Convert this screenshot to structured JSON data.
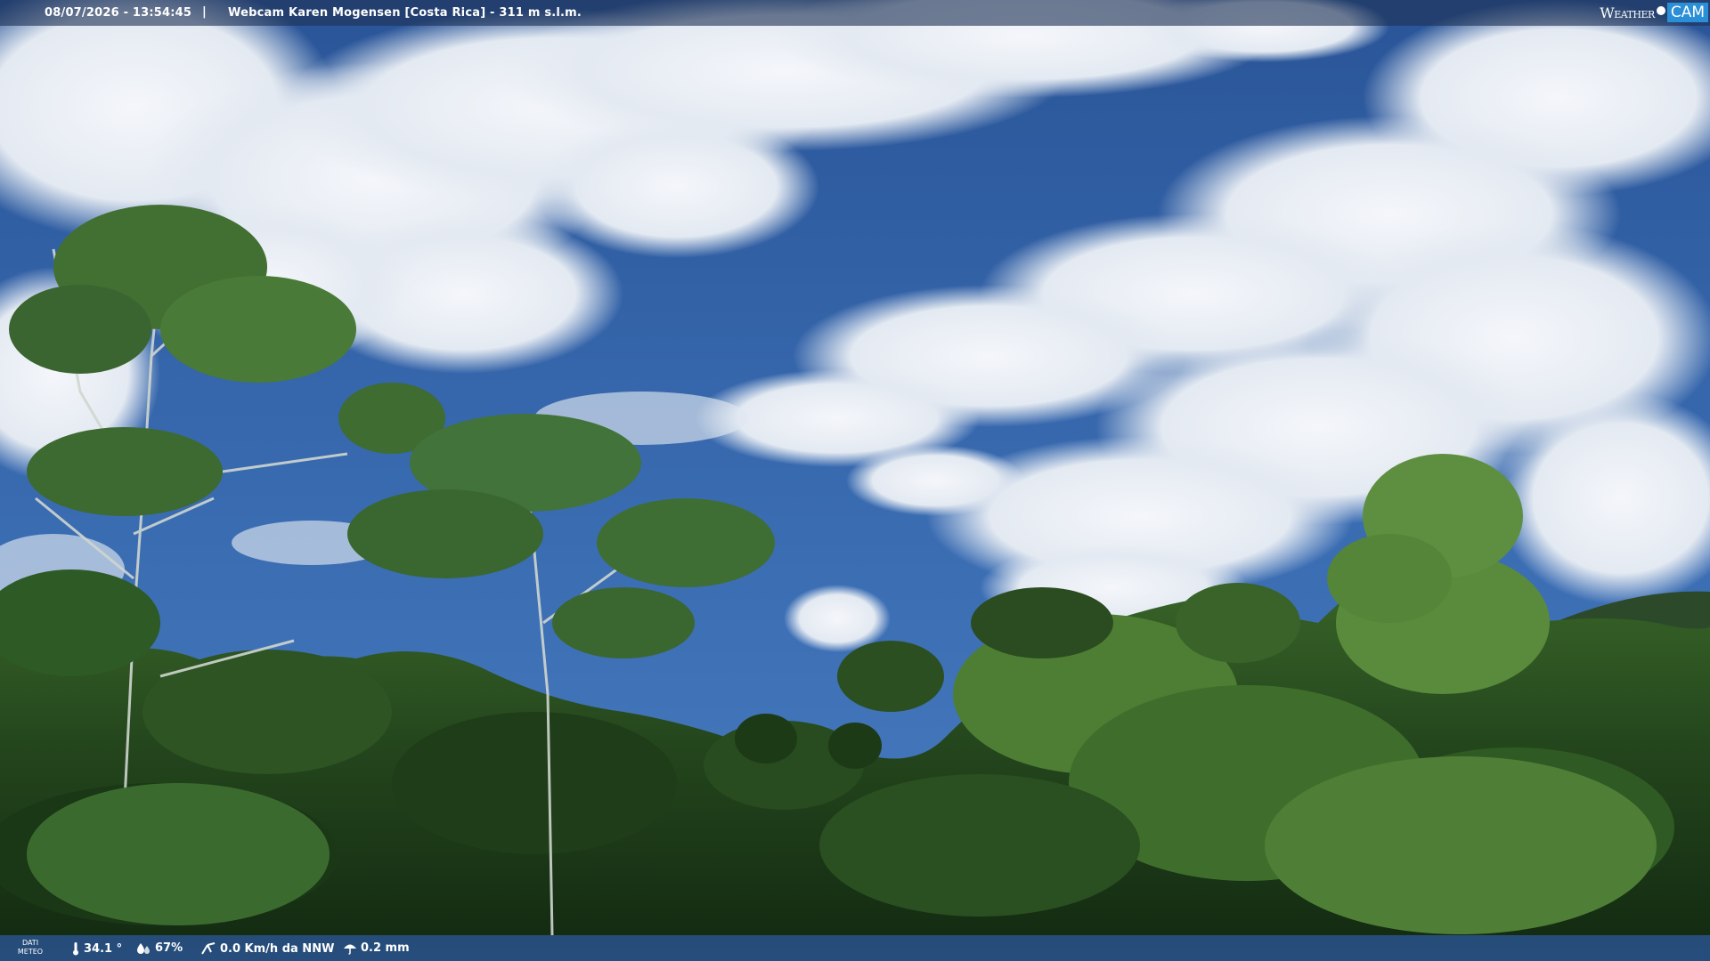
{
  "header": {
    "datetime": "08/07/2026 - 13:54:45",
    "separator": "|",
    "location": "Webcam Karen Mogensen [Costa Rica] - 311 m s.l.m."
  },
  "logo": {
    "weather": "Weather",
    "cam": "CAM"
  },
  "footer": {
    "label_line1": "DATI",
    "label_line2": "METEO",
    "temperature": "34.1 °",
    "humidity": "67%",
    "wind": "0.0 Km/h da NNW",
    "rain": "0.2 mm"
  },
  "colors": {
    "sky_top": "#2d5a9e",
    "sky_bottom": "#3a6db3",
    "cloud": "#eef2f7",
    "foliage_dark": "#1f3a1a",
    "foliage_mid": "#3d6b2c",
    "foliage_light": "#6f9a4a",
    "logo_accent": "#2a8fd6"
  }
}
